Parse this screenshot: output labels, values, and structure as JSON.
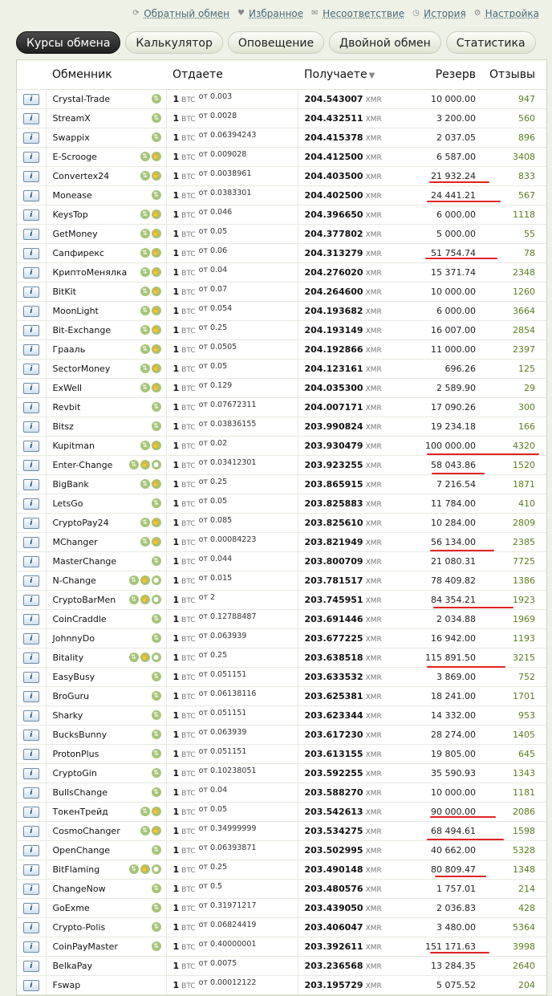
{
  "top_links": [
    {
      "icon": "refresh-icon",
      "label": "Обратный обмен"
    },
    {
      "icon": "heart-icon",
      "label": "Избранное"
    },
    {
      "icon": "mail-icon",
      "label": "Несоответствие"
    },
    {
      "icon": "clock-icon",
      "label": "История"
    },
    {
      "icon": "gear-icon",
      "label": "Настройка"
    }
  ],
  "tabs": [
    "Курсы обмена",
    "Калькулятор",
    "Оповещение",
    "Двойной обмен",
    "Статистика"
  ],
  "active_tab": 0,
  "columns": {
    "exchanger": "Обменник",
    "give": "Отдаете",
    "receive": "Получаете",
    "reserve": "Резерв",
    "reviews": "Отзывы"
  },
  "info_label": "i",
  "give_amount": "1",
  "give_currency": "BTC",
  "min_prefix": "от",
  "receive_currency": "XMR",
  "rows": [
    {
      "name": "Crystal-Trade",
      "icons": 1,
      "min": "0.003",
      "receive": "204.543007",
      "reserve": "10 000.00",
      "reviews": "947"
    },
    {
      "name": "StreamX",
      "icons": 1,
      "min": "0.0028",
      "receive": "204.432511",
      "reserve": "3 200.00",
      "reviews": "560"
    },
    {
      "name": "Swappix",
      "icons": 1,
      "min": "0.06394243",
      "receive": "204.415378",
      "reserve": "2 037.05",
      "reviews": "896"
    },
    {
      "name": "E-Scrooge",
      "icons": 2,
      "min": "0.009028",
      "receive": "204.412500",
      "reserve": "6 587.00",
      "reviews": "3408"
    },
    {
      "name": "Convertex24",
      "icons": 2,
      "min": "0.0038961",
      "receive": "204.403500",
      "reserve": "21 932.24",
      "reviews": "833"
    },
    {
      "name": "Monease",
      "icons": 1,
      "min": "0.0383301",
      "receive": "204.402500",
      "reserve": "24 441.21",
      "reviews": "567"
    },
    {
      "name": "KeysTop",
      "icons": 2,
      "min": "0.046",
      "receive": "204.396650",
      "reserve": "6 000.00",
      "reviews": "1118"
    },
    {
      "name": "GetMoney",
      "icons": 2,
      "min": "0.05",
      "receive": "204.377802",
      "reserve": "5 000.00",
      "reviews": "55"
    },
    {
      "name": "Сапфирекс",
      "icons": 2,
      "min": "0.06",
      "receive": "204.313279",
      "reserve": "51 754.74",
      "reviews": "78"
    },
    {
      "name": "КриптоМенялка",
      "icons": 2,
      "min": "0.04",
      "receive": "204.276020",
      "reserve": "15 371.74",
      "reviews": "2348"
    },
    {
      "name": "BitKit",
      "icons": 2,
      "min": "0.07",
      "receive": "204.264600",
      "reserve": "10 000.00",
      "reviews": "1260"
    },
    {
      "name": "MoonLight",
      "icons": 2,
      "min": "0.054",
      "receive": "204.193682",
      "reserve": "6 000.00",
      "reviews": "3664"
    },
    {
      "name": "Bit-Exchange",
      "icons": 2,
      "min": "0.25",
      "receive": "204.193149",
      "reserve": "16 007.00",
      "reviews": "2854"
    },
    {
      "name": "Грааль",
      "icons": 2,
      "min": "0.0505",
      "receive": "204.192866",
      "reserve": "11 000.00",
      "reviews": "2397"
    },
    {
      "name": "SectorMoney",
      "icons": 2,
      "min": "0.05",
      "receive": "204.123161",
      "reserve": "696.26",
      "reviews": "125"
    },
    {
      "name": "ExWell",
      "icons": 2,
      "min": "0.129",
      "receive": "204.035300",
      "reserve": "2 589.90",
      "reviews": "29"
    },
    {
      "name": "Revbit",
      "icons": 1,
      "min": "0.07672311",
      "receive": "204.007171",
      "reserve": "17 090.26",
      "reviews": "300"
    },
    {
      "name": "Bitsz",
      "icons": 1,
      "min": "0.03836155",
      "receive": "203.990824",
      "reserve": "19 234.18",
      "reviews": "166"
    },
    {
      "name": "Kupitman",
      "icons": 2,
      "min": "0.02",
      "receive": "203.930479",
      "reserve": "100 000.00",
      "reviews": "4320"
    },
    {
      "name": "Enter-Change",
      "icons": 3,
      "min": "0.03412301",
      "receive": "203.923255",
      "reserve": "58 043.86",
      "reviews": "1520"
    },
    {
      "name": "BigBank",
      "icons": 2,
      "min": "0.25",
      "receive": "203.865915",
      "reserve": "7 216.54",
      "reviews": "1871"
    },
    {
      "name": "LetsGo",
      "icons": 1,
      "min": "0.05",
      "receive": "203.825883",
      "reserve": "11 784.00",
      "reviews": "410"
    },
    {
      "name": "CryptoPay24",
      "icons": 2,
      "min": "0.085",
      "receive": "203.825610",
      "reserve": "10 284.00",
      "reviews": "2809"
    },
    {
      "name": "MChanger",
      "icons": 2,
      "min": "0.00084223",
      "receive": "203.821949",
      "reserve": "56 134.00",
      "reviews": "2385"
    },
    {
      "name": "MasterChange",
      "icons": 1,
      "min": "0.044",
      "receive": "203.800709",
      "reserve": "21 080.31",
      "reviews": "7725"
    },
    {
      "name": "N-Change",
      "icons": 3,
      "min": "0.015",
      "receive": "203.781517",
      "reserve": "78 409.82",
      "reviews": "1386"
    },
    {
      "name": "CryptoBarMen",
      "icons": 3,
      "min": "2",
      "receive": "203.745951",
      "reserve": "84 354.21",
      "reviews": "1923"
    },
    {
      "name": "CoinCraddle",
      "icons": 1,
      "min": "0.12788487",
      "receive": "203.691446",
      "reserve": "2 034.88",
      "reviews": "1969"
    },
    {
      "name": "JohnnyDo",
      "icons": 1,
      "min": "0.063939",
      "receive": "203.677225",
      "reserve": "16 942.00",
      "reviews": "1193"
    },
    {
      "name": "Bitality",
      "icons": 3,
      "min": "0.25",
      "receive": "203.638518",
      "reserve": "115 891.50",
      "reviews": "3215"
    },
    {
      "name": "EasyBusy",
      "icons": 1,
      "min": "0.051151",
      "receive": "203.633532",
      "reserve": "3 869.00",
      "reviews": "752"
    },
    {
      "name": "BroGuru",
      "icons": 1,
      "min": "0.06138116",
      "receive": "203.625381",
      "reserve": "18 241.00",
      "reviews": "1701"
    },
    {
      "name": "Sharky",
      "icons": 1,
      "min": "0.051151",
      "receive": "203.623344",
      "reserve": "14 332.00",
      "reviews": "953"
    },
    {
      "name": "BucksBunny",
      "icons": 1,
      "min": "0.063939",
      "receive": "203.617230",
      "reserve": "28 274.00",
      "reviews": "1405"
    },
    {
      "name": "ProtonPlus",
      "icons": 1,
      "min": "0.051151",
      "receive": "203.613155",
      "reserve": "19 805.00",
      "reviews": "645"
    },
    {
      "name": "CryptoGin",
      "icons": 1,
      "min": "0.10238051",
      "receive": "203.592255",
      "reserve": "35 590.93",
      "reviews": "1343"
    },
    {
      "name": "BullsChange",
      "icons": 1,
      "min": "0.04",
      "receive": "203.588270",
      "reserve": "10 000.00",
      "reviews": "1181"
    },
    {
      "name": "ТокенТрейд",
      "icons": 2,
      "min": "0.05",
      "receive": "203.542613",
      "reserve": "90 000.00",
      "reviews": "2086"
    },
    {
      "name": "CosmoChanger",
      "icons": 2,
      "min": "0.34999999",
      "receive": "203.534275",
      "reserve": "68 494.61",
      "reviews": "1598"
    },
    {
      "name": "OpenChange",
      "icons": 1,
      "min": "0.06393871",
      "receive": "203.502995",
      "reserve": "40 662.00",
      "reviews": "5328"
    },
    {
      "name": "BitFlaming",
      "icons": 3,
      "min": "0.25",
      "receive": "203.490148",
      "reserve": "80 809.47",
      "reviews": "1348"
    },
    {
      "name": "ChangeNow",
      "icons": 1,
      "min": "0.5",
      "receive": "203.480576",
      "reserve": "1 757.01",
      "reviews": "214"
    },
    {
      "name": "GoExme",
      "icons": 1,
      "min": "0.31971217",
      "receive": "203.439050",
      "reserve": "2 036.83",
      "reviews": "428"
    },
    {
      "name": "Crypto-Polis",
      "icons": 1,
      "min": "0.06824419",
      "receive": "203.406047",
      "reserve": "3 480.00",
      "reviews": "5364"
    },
    {
      "name": "CoinPayMaster",
      "icons": 1,
      "min": "0.40000001",
      "receive": "203.392611",
      "reserve": "151 171.63",
      "reviews": "3998"
    },
    {
      "name": "BelkaPay",
      "icons": 0,
      "min": "0.0075",
      "receive": "203.236568",
      "reserve": "13 284.35",
      "reviews": "2640"
    },
    {
      "name": "Fswap",
      "icons": 0,
      "min": "0.00012122",
      "receive": "203.195729",
      "reserve": "5 075.52",
      "reviews": "204"
    }
  ],
  "annotation_color": "#e22222"
}
